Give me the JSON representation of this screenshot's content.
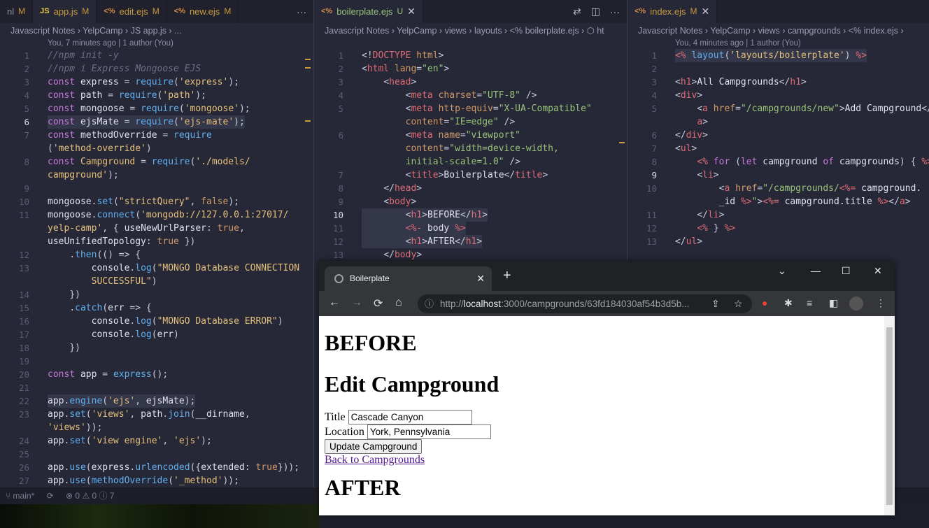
{
  "pane1": {
    "tabs": [
      {
        "icon": "",
        "label": "nl",
        "status": "M"
      },
      {
        "icon": "JS",
        "label": "app.js",
        "status": "M"
      },
      {
        "icon": "<%",
        "label": "edit.ejs",
        "status": "M"
      },
      {
        "icon": "<%",
        "label": "new.ejs",
        "status": "M"
      }
    ],
    "more": "···",
    "breadcrumb": "Javascript Notes  ›  YelpCamp  ›  JS  app.js  ›  ...",
    "blame": "You, 7 minutes ago | 1 author (You)"
  },
  "pane2": {
    "tabs": [
      {
        "icon": "<%",
        "label": "boilerplate.ejs",
        "status": "U",
        "close": "✕"
      }
    ],
    "breadcrumb": "Javascript Notes  ›  YelpCamp  ›  views  ›  layouts  ›  <%  boilerplate.ejs  ›  ⬡ ht"
  },
  "pane3": {
    "tabs": [
      {
        "icon": "<%",
        "label": "index.ejs",
        "status": "M",
        "close": "✕"
      }
    ],
    "breadcrumb": "Javascript Notes  ›  YelpCamp  ›  views  ›  campgrounds  ›  <%  index.ejs  ›",
    "blame": "You, 4 minutes ago | 1 author (You)"
  },
  "status": {
    "branch": "main*",
    "errors": "⊗ 0 ⚠ 0 ⓘ 7"
  },
  "browser": {
    "tab_title": "Boilerplate",
    "url_prefix": "http://",
    "url_host": "localhost",
    "url_rest": ":3000/campgrounds/63fd184030af54b3d5b...",
    "page": {
      "h_before": "BEFORE",
      "h_title": "Edit Campground",
      "title_label": "Title",
      "title_value": "Cascade Canyon",
      "location_label": "Location",
      "location_value": "York, Pennsylvania",
      "submit": "Update Campground",
      "back_link": "Back to Campgrounds",
      "h_after": "AFTER"
    }
  }
}
